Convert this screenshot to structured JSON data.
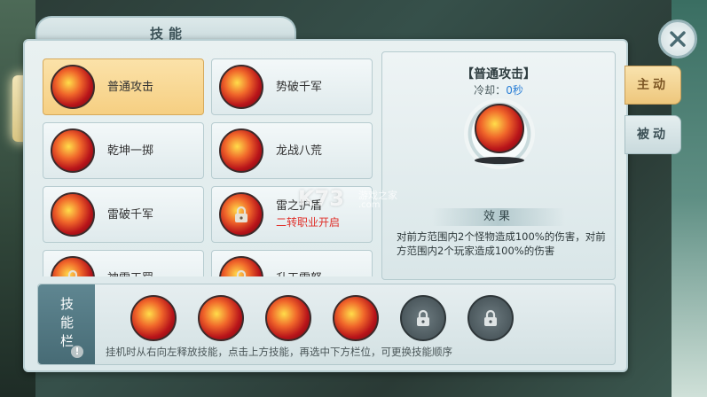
{
  "window": {
    "title": "技能"
  },
  "close": {
    "icon": "close-icon"
  },
  "tabs": [
    {
      "label": "主动",
      "active": true
    },
    {
      "label": "被动",
      "active": false
    }
  ],
  "skills": [
    {
      "name": "普通攻击",
      "selected": true
    },
    {
      "name": "势破千军"
    },
    {
      "name": "乾坤一掷"
    },
    {
      "name": "龙战八荒"
    },
    {
      "name": "雷破千军"
    },
    {
      "name": "雷之护盾",
      "sub": "二转职业开启",
      "locked": true
    },
    {
      "name": "神雷天罚",
      "locked": true
    },
    {
      "name": "升天雷怒",
      "locked": true
    }
  ],
  "detail": {
    "name": "【普通攻击】",
    "cd_label": "冷却：",
    "cd_value": "0秒",
    "effect_title": "效果",
    "effect_text": "对前方范围内2个怪物造成100%的伤害，对前方范围内2个玩家造成100%的伤害"
  },
  "skill_bar": {
    "label": "技能栏",
    "slots": [
      "equipped",
      "equipped",
      "equipped",
      "equipped",
      "locked",
      "locked"
    ],
    "hint": "挂机时从右向左释放技能，点击上方技能，再选中下方栏位，可更换技能顺序"
  },
  "watermark": {
    "main": "K73",
    "sub1": "游戏之家",
    "sub2": ".com"
  },
  "colors": {
    "accent_gold": "#f6cf82",
    "red_text": "#e0302a",
    "cd_blue": "#2a7fd6"
  }
}
